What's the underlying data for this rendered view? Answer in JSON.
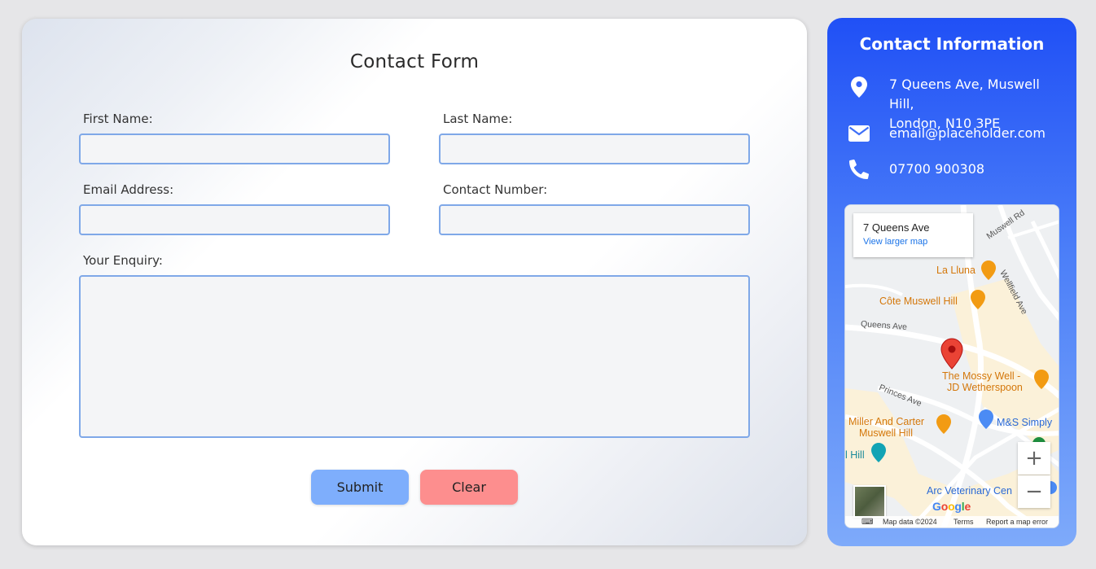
{
  "form": {
    "title": "Contact Form",
    "first_name_label": "First Name:",
    "last_name_label": "Last Name:",
    "email_label": "Email Address:",
    "contact_number_label": "Contact Number:",
    "enquiry_label": "Your Enquiry:",
    "first_name_value": "",
    "last_name_value": "",
    "email_value": "",
    "contact_number_value": "",
    "enquiry_value": "",
    "submit_label": "Submit",
    "clear_label": "Clear"
  },
  "contact_info": {
    "title": "Contact Information",
    "address_line1": "7 Queens Ave, Muswell Hill,",
    "address_line2": "London, N10 3PE",
    "email": "email@placeholder.com",
    "phone": "07700 900308",
    "icons": [
      "map-pin-icon",
      "envelope-icon",
      "phone-icon"
    ]
  },
  "map": {
    "popup_place": "7 Queens Ave",
    "popup_link": "View larger map",
    "roads": [
      "Muswell Rd",
      "Wellfield Ave",
      "Queens Ave",
      "Princes Ave"
    ],
    "pois": {
      "la_lluna": "La Lluna",
      "cote": "Côte Muswell Hill",
      "mossy_1": "The Mossy Well -",
      "mossy_2": "JD Wetherspoon",
      "miller_1": "Miller And Carter",
      "miller_2": "Muswell Hill",
      "ms": "M&S Simply",
      "hill": "l Hill",
      "arc": "Arc Veterinary Cen"
    },
    "zoom_in": "+",
    "zoom_out": "−",
    "google": "Google",
    "map_data": "Map data ©2024",
    "terms": "Terms",
    "report": "Report a map error"
  },
  "colors": {
    "accent_blue": "#2050f6",
    "input_border": "#7fa8e8",
    "submit_bg": "#7eaefc",
    "clear_bg": "#fd8e8e"
  }
}
